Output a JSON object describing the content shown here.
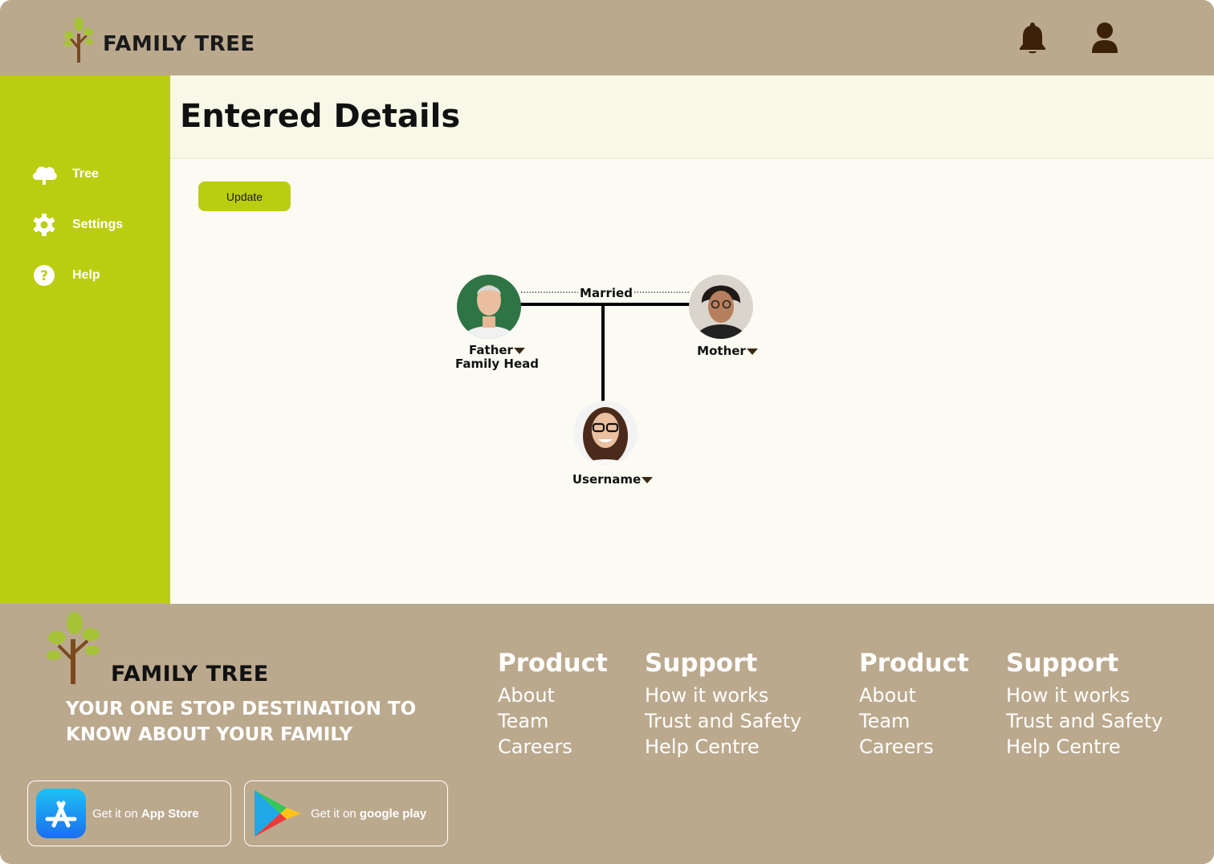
{
  "app": {
    "brand": "FAMILY TREE"
  },
  "header": {
    "icons": [
      "bell-icon",
      "user-icon"
    ]
  },
  "sidebar": {
    "items": [
      {
        "label": "Tree",
        "icon": "cloud-icon"
      },
      {
        "label": "Settings",
        "icon": "gear-icon"
      },
      {
        "label": "Help",
        "icon": "help-icon"
      }
    ]
  },
  "main": {
    "title": "Entered Details",
    "update_label": "Update",
    "tree": {
      "relation_label": "Married",
      "father": {
        "label": "Father",
        "sublabel": "Family Head"
      },
      "mother": {
        "label": "Mother"
      },
      "child": {
        "label": "Username"
      }
    }
  },
  "footer": {
    "brand": "FAMILY TREE",
    "tagline": "YOUR ONE STOP DESTINATION TO KNOW ABOUT YOUR FAMILY",
    "app_store": {
      "prefix": "Get it on ",
      "name": "App Store"
    },
    "google_play": {
      "prefix": "Get it on ",
      "name": "google play"
    },
    "columns": [
      {
        "heading": "Product",
        "links": [
          "About",
          "Team",
          "Careers"
        ]
      },
      {
        "heading": "Support",
        "links": [
          "How it works",
          "Trust and Safety",
          "Help Centre"
        ]
      },
      {
        "heading": "Product",
        "links": [
          "About",
          "Team",
          "Careers"
        ]
      },
      {
        "heading": "Support",
        "links": [
          "How it works",
          "Trust and Safety",
          "Help Centre"
        ]
      }
    ]
  },
  "colors": {
    "brown": "#bba98e",
    "lime": "#bbcd10",
    "dark_icon": "#3b2207"
  }
}
